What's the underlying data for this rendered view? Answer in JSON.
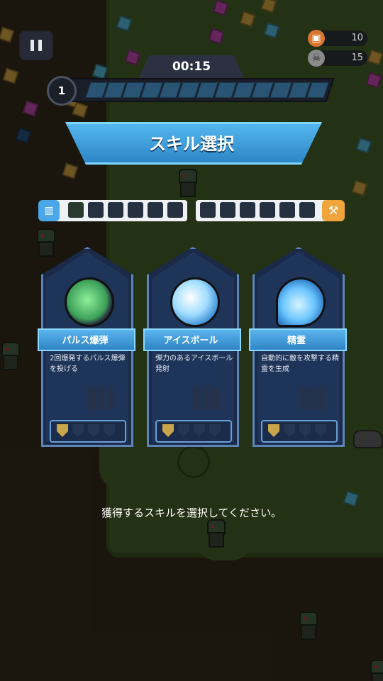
{
  "hud": {
    "timer": "00:15",
    "level": "1",
    "coins": "10",
    "kills": "15",
    "coin_icon": "coin-icon",
    "skull_icon": "skull-icon",
    "xp_progress": 0
  },
  "banner": {
    "title": "スキル選択"
  },
  "slots": {
    "weapon_icon": "ammo-icon",
    "passive_icon": "hammer-icon"
  },
  "cards": [
    {
      "name": "パルス爆弾",
      "desc": "2回爆発するパルス爆弾を投げる",
      "level": 1,
      "max_level": 4,
      "icon": "pulse-bomb-icon"
    },
    {
      "name": "アイスボール",
      "desc": "弾力のあるアイスボール発射",
      "level": 1,
      "max_level": 4,
      "icon": "ice-ball-icon"
    },
    {
      "name": "精霊",
      "desc": "自動的に敵を攻撃する精霊を生成",
      "level": 1,
      "max_level": 4,
      "icon": "spirit-icon"
    }
  ],
  "prompt": "獲得するスキルを選択してください。",
  "colors": {
    "accent": "#3fa0e3",
    "card_bg": "#1e3458",
    "gold": "#c9a64a"
  }
}
